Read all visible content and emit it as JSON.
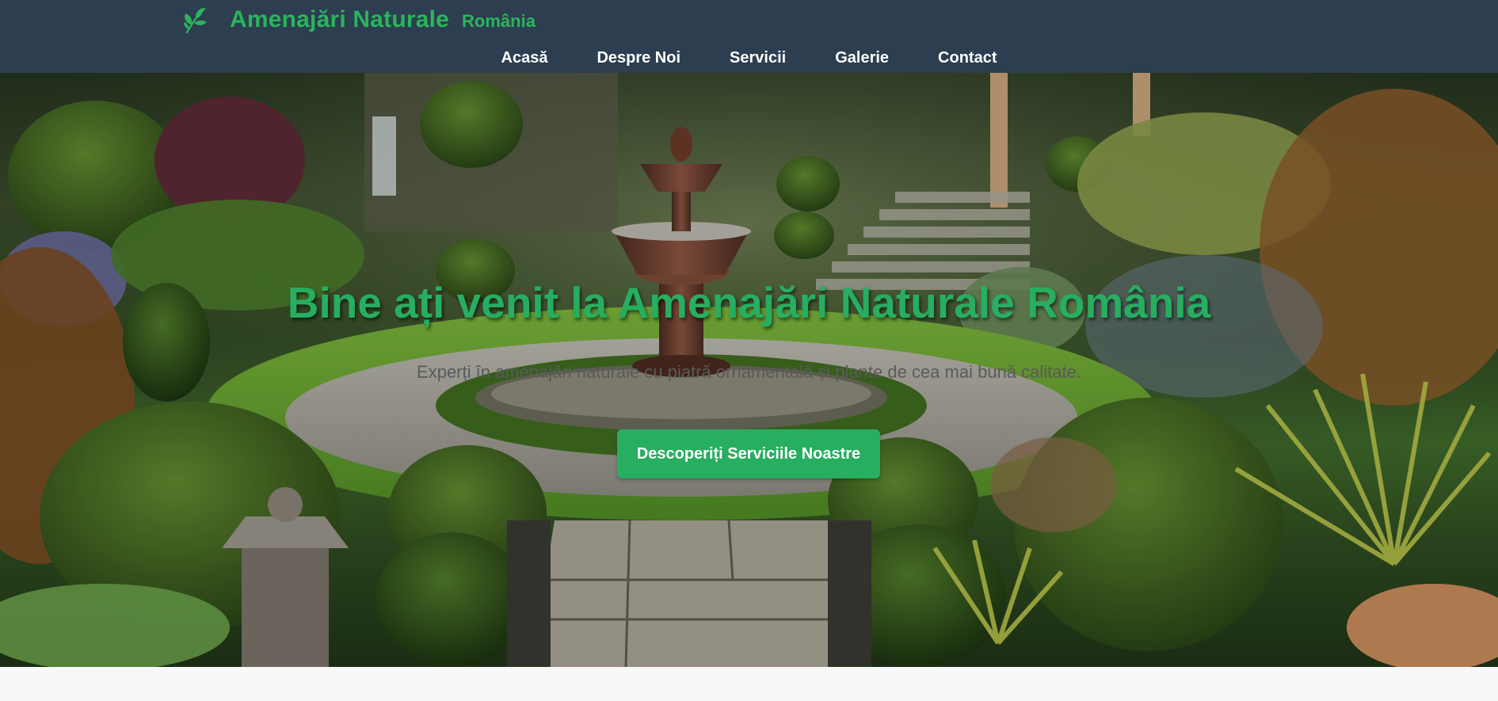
{
  "header": {
    "brand_name": "Amenajări Naturale",
    "brand_sub": "România",
    "logo_icon": "leaf-sprig-icon"
  },
  "nav": {
    "items": [
      {
        "label": "Acasă"
      },
      {
        "label": "Despre Noi"
      },
      {
        "label": "Servicii"
      },
      {
        "label": "Galerie"
      },
      {
        "label": "Contact"
      }
    ]
  },
  "hero": {
    "title": "Bine ați venit la Amenajări Naturale România",
    "subtitle": "Experți în amenajări naturale cu piatră ornamentală și plante de cea mai bună calitate.",
    "cta_label": "Descoperiți Serviciile Noastre",
    "background_image": "garden-fountain-photo"
  },
  "colors": {
    "header_bg": "#2c3e50",
    "brand_green": "#27ae60",
    "nav_text": "#ffffff",
    "subtitle_text": "#5a5a5a",
    "page_bg": "#f8f8f8"
  }
}
